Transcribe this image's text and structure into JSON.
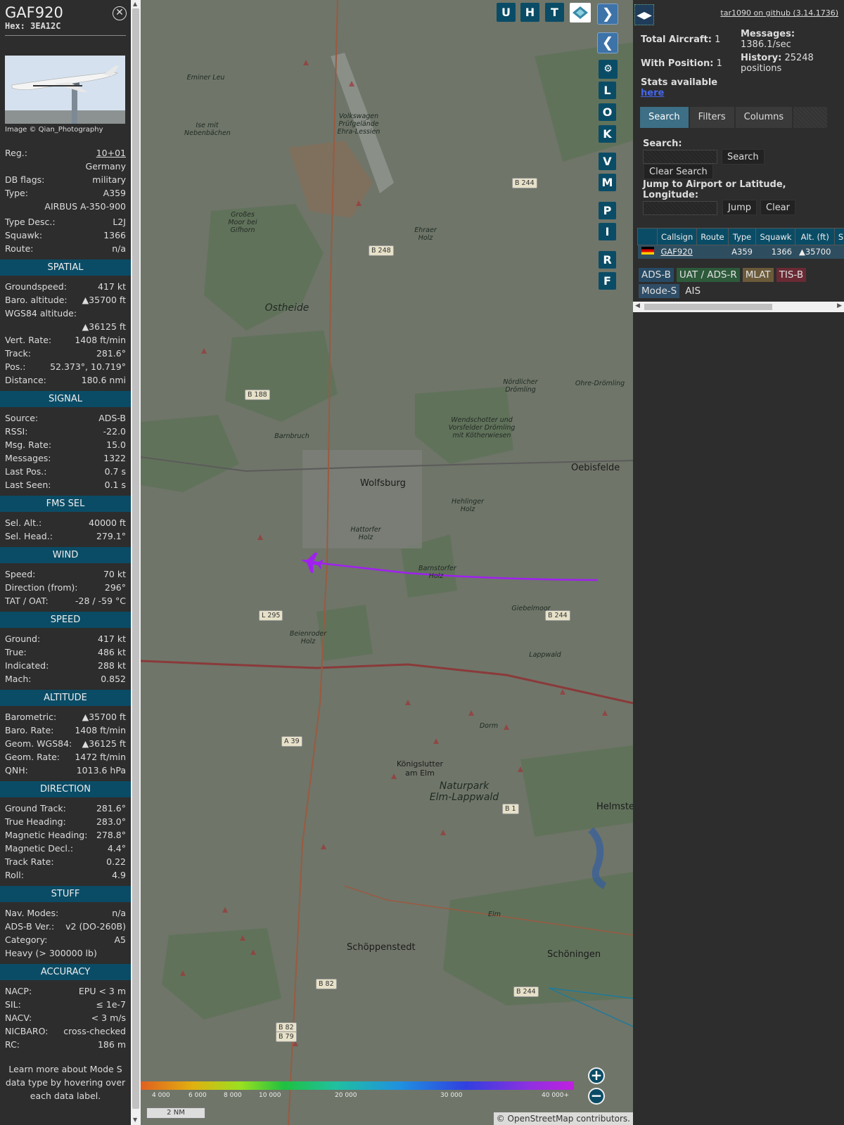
{
  "info": {
    "callsign": "GAF920",
    "hex": "Hex: 3EA12C",
    "photo_credit": "Image © Qian_Photography",
    "top_rows": [
      {
        "k": "Reg.:",
        "v": "10+01"
      },
      {
        "k": "",
        "v": "Germany"
      },
      {
        "k": "DB flags:",
        "v": "military"
      },
      {
        "k": "Type:",
        "v": "A359"
      },
      {
        "k": "",
        "v": "AIRBUS A-350-900"
      }
    ],
    "type_rows": [
      {
        "k": "Type Desc.:",
        "v": "L2J"
      },
      {
        "k": "Squawk:",
        "v": "1366"
      },
      {
        "k": "Route:",
        "v": "n/a"
      }
    ],
    "sections": [
      {
        "title": "SPATIAL",
        "rows": [
          {
            "k": "Groundspeed:",
            "v": "417 kt"
          },
          {
            "k": "Baro. altitude:",
            "v": "▲35700 ft"
          },
          {
            "k": "WGS84 altitude:",
            "v": ""
          },
          {
            "k": "",
            "v": "▲36125 ft"
          },
          {
            "k": "Vert. Rate:",
            "v": "1408 ft/min"
          },
          {
            "k": "Track:",
            "v": "281.6°"
          },
          {
            "k": "Pos.:",
            "v": "52.373°, 10.719°"
          },
          {
            "k": "Distance:",
            "v": "180.6 nmi"
          }
        ]
      },
      {
        "title": "SIGNAL",
        "rows": [
          {
            "k": "Source:",
            "v": "ADS-B"
          },
          {
            "k": "RSSI:",
            "v": "-22.0"
          },
          {
            "k": "Msg. Rate:",
            "v": "15.0"
          },
          {
            "k": "Messages:",
            "v": "1322"
          },
          {
            "k": "Last Pos.:",
            "v": "0.7 s"
          },
          {
            "k": "Last Seen:",
            "v": "0.1 s"
          }
        ]
      },
      {
        "title": "FMS SEL",
        "rows": [
          {
            "k": "Sel. Alt.:",
            "v": "40000 ft"
          },
          {
            "k": "Sel. Head.:",
            "v": "279.1°"
          }
        ]
      },
      {
        "title": "WIND",
        "rows": [
          {
            "k": "Speed:",
            "v": "70 kt"
          },
          {
            "k": "Direction (from):",
            "v": "296°"
          },
          {
            "k": "TAT / OAT:",
            "v": "-28 / -59 °C"
          }
        ]
      },
      {
        "title": "SPEED",
        "rows": [
          {
            "k": "Ground:",
            "v": "417 kt"
          },
          {
            "k": "True:",
            "v": "486 kt"
          },
          {
            "k": "Indicated:",
            "v": "288 kt"
          },
          {
            "k": "Mach:",
            "v": "0.852"
          }
        ]
      },
      {
        "title": "ALTITUDE",
        "rows": [
          {
            "k": "Barometric:",
            "v": "▲35700 ft"
          },
          {
            "k": "Baro. Rate:",
            "v": "1408 ft/min"
          },
          {
            "k": "Geom. WGS84:",
            "v": "▲36125 ft"
          },
          {
            "k": "Geom. Rate:",
            "v": "1472 ft/min"
          },
          {
            "k": "QNH:",
            "v": "1013.6 hPa"
          }
        ]
      },
      {
        "title": "DIRECTION",
        "rows": [
          {
            "k": "Ground Track:",
            "v": "281.6°"
          },
          {
            "k": "True Heading:",
            "v": "283.0°"
          },
          {
            "k": "Magnetic Heading:",
            "v": "278.8°"
          },
          {
            "k": "Magnetic Decl.:",
            "v": "4.4°"
          },
          {
            "k": "Track Rate:",
            "v": "0.22"
          },
          {
            "k": "Roll:",
            "v": "4.9"
          }
        ]
      },
      {
        "title": "STUFF",
        "rows": [
          {
            "k": "Nav. Modes:",
            "v": "n/a"
          },
          {
            "k": "ADS-B Ver.:",
            "v": "v2 (DO-260B)"
          },
          {
            "k": "Category:",
            "v": "A5"
          },
          {
            "k": "Heavy (> 300000 lb)",
            "v": ""
          }
        ]
      },
      {
        "title": "ACCURACY",
        "rows": [
          {
            "k": "NACP:",
            "v": "EPU < 3 m"
          },
          {
            "k": "SIL:",
            "v": "≤ 1e-7"
          },
          {
            "k": "NACV:",
            "v": "< 3 m/s"
          },
          {
            "k": "NICBARO:",
            "v": "cross-checked"
          },
          {
            "k": "RC:",
            "v": "186 m"
          }
        ]
      }
    ],
    "note": "Learn more about Mode S data type by hovering over each data label."
  },
  "map": {
    "overlay_buttons": [
      "U",
      "H",
      "T"
    ],
    "side_buttons": [
      "L",
      "O",
      "K",
      "V",
      "M",
      "P",
      "I",
      "R",
      "F"
    ],
    "cities": [
      "Wolfsburg",
      "Oebisfelde",
      "Königslutter am Elm",
      "Helmstedt",
      "Schöningen",
      "Schöppenstedt"
    ],
    "places": [
      "Ostheide",
      "Großes Moor bei Gifhorn",
      "Volkswagen Prüfgelände Ehra-Lessien",
      "Ehraer Holz",
      "Barnbruch",
      "Hattorfer Holz",
      "Hehlinger Holz",
      "Barnstorfer Holz",
      "Beienroder Holz",
      "Naturpark Elm-Lappwald",
      "Lappwald",
      "Dorm",
      "Elm",
      "Giebelmoor",
      "Nördlicher Drömling",
      "Ohre-Drömling",
      "Wendschotter und Vorsfelder Drömling mit Kötherwiesen",
      "Eminer Leu",
      "Ise mit Nebenbächen"
    ],
    "roads": [
      "B 244",
      "B 248",
      "B 188",
      "L 295",
      "B 244",
      "A 39",
      "B 1",
      "B 82",
      "B 244",
      "B 82",
      "B 79"
    ],
    "legend_ticks": [
      "4 000",
      "6 000",
      "8 000",
      "10 000",
      "20 000",
      "30 000",
      "40 000+"
    ],
    "scale": "2 NM",
    "attribution": "© OpenStreetMap contributors."
  },
  "sidebar": {
    "github": "tar1090 on github (3.14.1736)",
    "total_label": "Total Aircraft:",
    "total": "1",
    "pos_label": "With Position:",
    "pos": "1",
    "msg_label": "Messages:",
    "msg": "1386.1/sec",
    "hist_label": "History:",
    "hist": "25248 positions",
    "stats_label": "Stats available",
    "stats_link": "here",
    "tabs": [
      "Search",
      "Filters",
      "Columns"
    ],
    "search_label": "Search:",
    "search_btn": "Search",
    "clear_search_btn": "Clear Search",
    "jump_label": "Jump to Airport or Latitude, Longitude:",
    "jump_btn": "Jump",
    "clear_btn": "Clear",
    "columns": [
      "Callsign",
      "Route",
      "Type",
      "Squawk",
      "Alt. (ft)",
      "Spd"
    ],
    "row": {
      "callsign": "GAF920",
      "route": "",
      "type": "A359",
      "squawk": "1366",
      "alt": "▲35700",
      "spd": ""
    },
    "sources": [
      {
        "label": "ADS-B",
        "color": "#274a64"
      },
      {
        "label": "UAT / ADS-R",
        "color": "#2d5a3a"
      },
      {
        "label": "MLAT",
        "color": "#6b5a3a"
      },
      {
        "label": "TIS-B",
        "color": "#6a2a34"
      },
      {
        "label": "Mode-S",
        "color": "#2f4d66"
      },
      {
        "label": "AIS",
        "color": "#2d2d2d"
      }
    ]
  }
}
